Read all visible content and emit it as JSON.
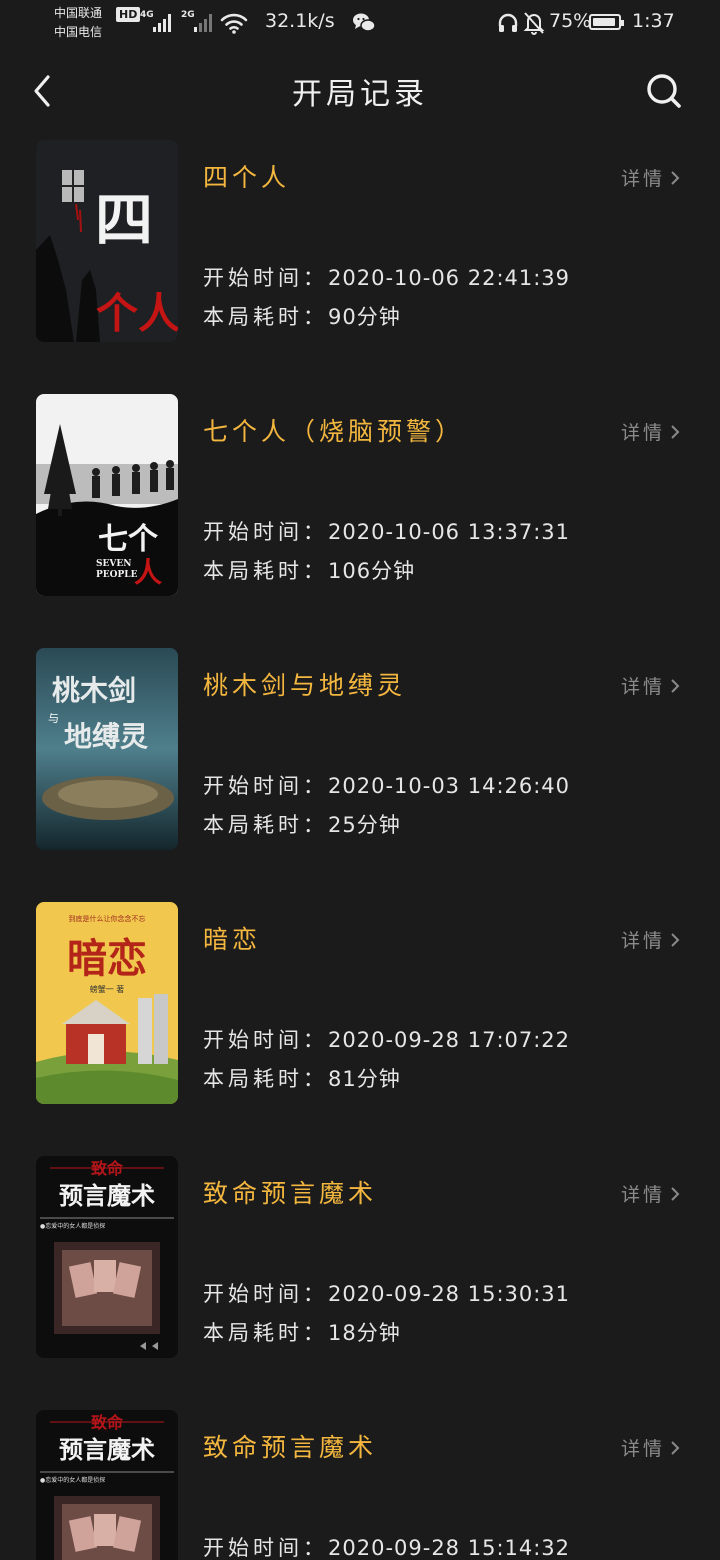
{
  "status_bar": {
    "carrier_1": "中国联通",
    "carrier_2": "中国电信",
    "hd": "HD",
    "net_1": "4G",
    "net_2": "2G",
    "speed": "32.1k/s",
    "battery": "75%",
    "time": "1:37"
  },
  "header": {
    "title": "开局记录"
  },
  "labels": {
    "detail": "详情",
    "start_label": "开始时间：",
    "duration_label": "本局耗时："
  },
  "records": [
    {
      "title": "四个人",
      "start_time": "2020-10-06 22:41:39",
      "duration": "90分钟",
      "cover_text": [
        "四",
        "个人"
      ]
    },
    {
      "title": "七个人（烧脑预警）",
      "start_time": "2020-10-06 13:37:31",
      "duration": "106分钟",
      "cover_text": [
        "七个",
        "人",
        "SEVEN",
        "PEOPLE"
      ]
    },
    {
      "title": "桃木剑与地缚灵",
      "start_time": "2020-10-03 14:26:40",
      "duration": "25分钟",
      "cover_text": [
        "桃木剑",
        "与",
        "地缚灵"
      ]
    },
    {
      "title": "暗恋",
      "start_time": "2020-09-28 17:07:22",
      "duration": "81分钟",
      "cover_text": [
        "到底是什么让你念念不忘",
        "暗恋",
        "螃蟹一 著"
      ]
    },
    {
      "title": "致命预言魔术",
      "start_time": "2020-09-28 15:30:31",
      "duration": "18分钟",
      "cover_text": [
        "致命",
        "预言魔术",
        "●恋爱中的女人都是侦探"
      ]
    },
    {
      "title": "致命预言魔术",
      "start_time": "2020-09-28 15:14:32",
      "duration": "",
      "cover_text": [
        "致命",
        "预言魔术",
        "●恋爱中的女人都是侦探"
      ]
    }
  ]
}
